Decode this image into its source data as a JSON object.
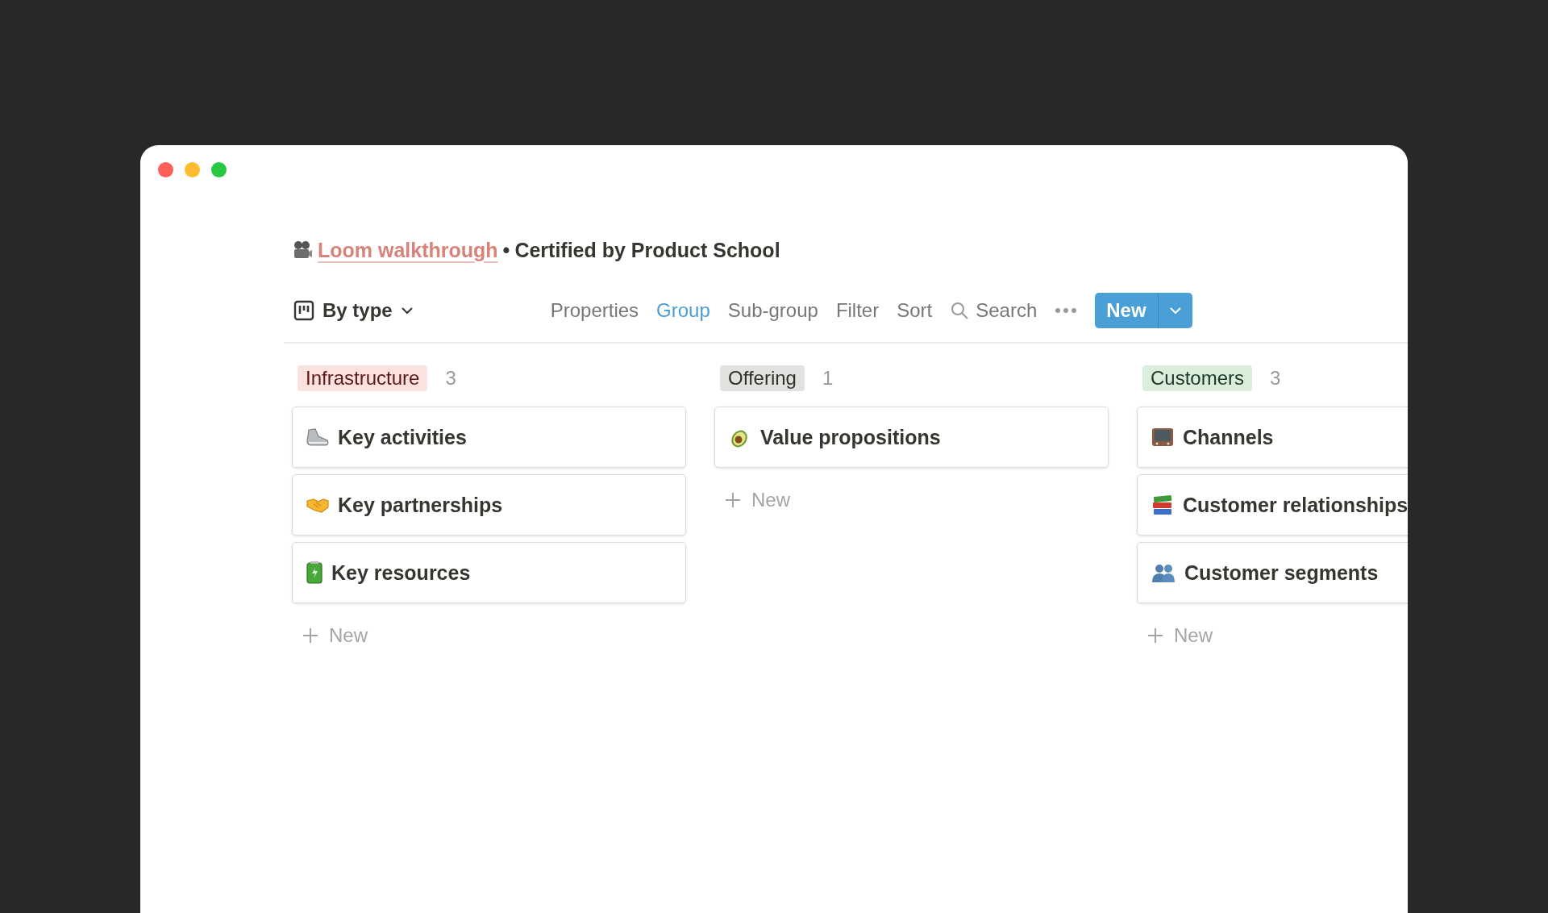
{
  "breadcrumb": {
    "link": "Loom walkthrough",
    "separator": "•",
    "rest": "Certified by Product School"
  },
  "toolbar": {
    "view": "By type",
    "actions": [
      {
        "label": "Properties",
        "selected": false
      },
      {
        "label": "Group",
        "selected": true
      },
      {
        "label": "Sub-group",
        "selected": false
      },
      {
        "label": "Filter",
        "selected": false
      },
      {
        "label": "Sort",
        "selected": false
      }
    ],
    "search": "Search",
    "new_button": "New"
  },
  "columns": [
    {
      "label": "Infrastructure",
      "color": "#fbe2de",
      "count": "3",
      "cards": [
        "Key activities",
        "Key partnerships",
        "Key resources"
      ],
      "add_label": "New"
    },
    {
      "label": "Offering",
      "color": "#e3e2e0",
      "count": "1",
      "cards": [
        "Value propositions"
      ],
      "add_label": "New"
    },
    {
      "label": "Customers",
      "color": "#dbeddb",
      "count": "3",
      "cards": [
        "Channels",
        "Customer relationships",
        "Customer segments"
      ],
      "add_label": "New"
    }
  ]
}
